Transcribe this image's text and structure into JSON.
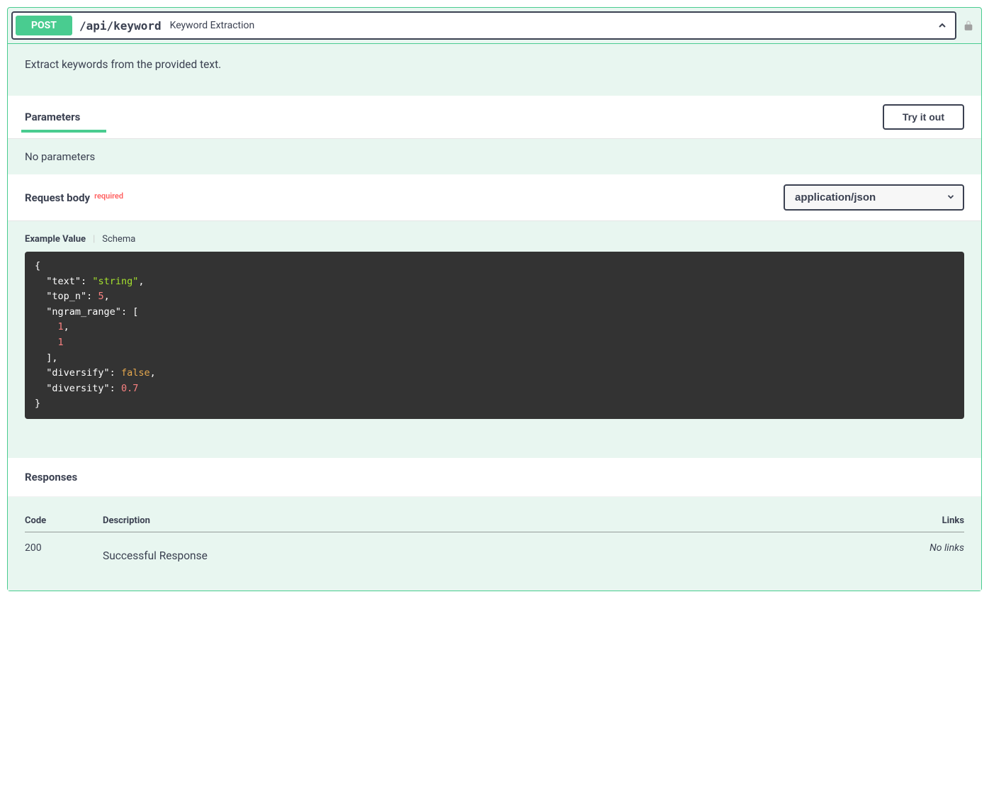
{
  "operation": {
    "method": "POST",
    "path": "/api/keyword",
    "summary": "Keyword Extraction",
    "description": "Extract keywords from the provided text."
  },
  "parameters": {
    "section_title": "Parameters",
    "try_out_label": "Try it out",
    "empty_message": "No parameters"
  },
  "request_body": {
    "section_title": "Request body",
    "required_label": "required",
    "content_type": "application/json",
    "example_tab": "Example Value",
    "schema_tab": "Schema",
    "example": {
      "text": "string",
      "top_n": 5,
      "ngram_range": [
        1,
        1
      ],
      "diversify": false,
      "diversity": 0.7
    }
  },
  "responses": {
    "section_title": "Responses",
    "columns": {
      "code": "Code",
      "description": "Description",
      "links": "Links"
    },
    "items": [
      {
        "code": "200",
        "description": "Successful Response",
        "links": "No links"
      }
    ]
  }
}
